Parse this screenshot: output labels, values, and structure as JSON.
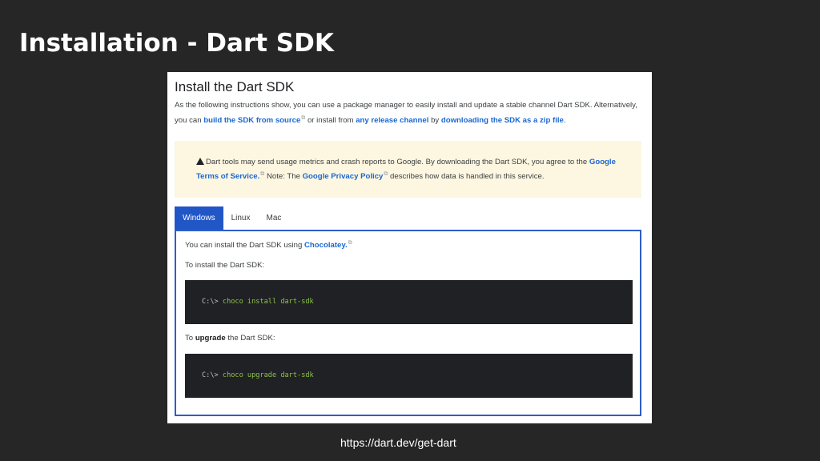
{
  "slide": {
    "title": "Installation - Dart SDK",
    "url": "https://dart.dev/get-dart"
  },
  "page": {
    "heading": "Install the Dart SDK",
    "intro": {
      "text1": "As the following instructions show, you can use a package manager to easily install and update a stable channel Dart SDK. Alternatively, you can ",
      "link1": "build the SDK from source",
      "text2": " or install from ",
      "link2": "any release channel",
      "text3": " by ",
      "link3": "downloading the SDK as a zip file",
      "text4": "."
    },
    "notice": {
      "text1": "Dart tools may send usage metrics and crash reports to Google. By downloading the Dart SDK, you agree to the ",
      "link1": "Google Terms of Service.",
      "text2": " Note: The ",
      "link2": "Google Privacy Policy",
      "text3": " describes how data is handled in this service."
    },
    "tabs": [
      {
        "label": "Windows",
        "active": true
      },
      {
        "label": "Linux",
        "active": false
      },
      {
        "label": "Mac",
        "active": false
      }
    ],
    "panel": {
      "line1_text": "You can install the Dart SDK using ",
      "line1_link": "Chocolatey.",
      "line2": "To install the Dart SDK:",
      "code1": {
        "prompt": "C:\\>",
        "command": "choco install dart-sdk"
      },
      "line3_pre": "To ",
      "line3_bold": "upgrade",
      "line3_post": " the Dart SDK:",
      "code2": {
        "prompt": "C:\\>",
        "command": "choco upgrade dart-sdk"
      }
    }
  },
  "colors": {
    "slide_background": "#262626",
    "link": "#1967d2",
    "notice_background": "#fdf6e0",
    "tab_active": "#2156c7",
    "code_background": "#202124",
    "code_command": "#8bc34a"
  }
}
